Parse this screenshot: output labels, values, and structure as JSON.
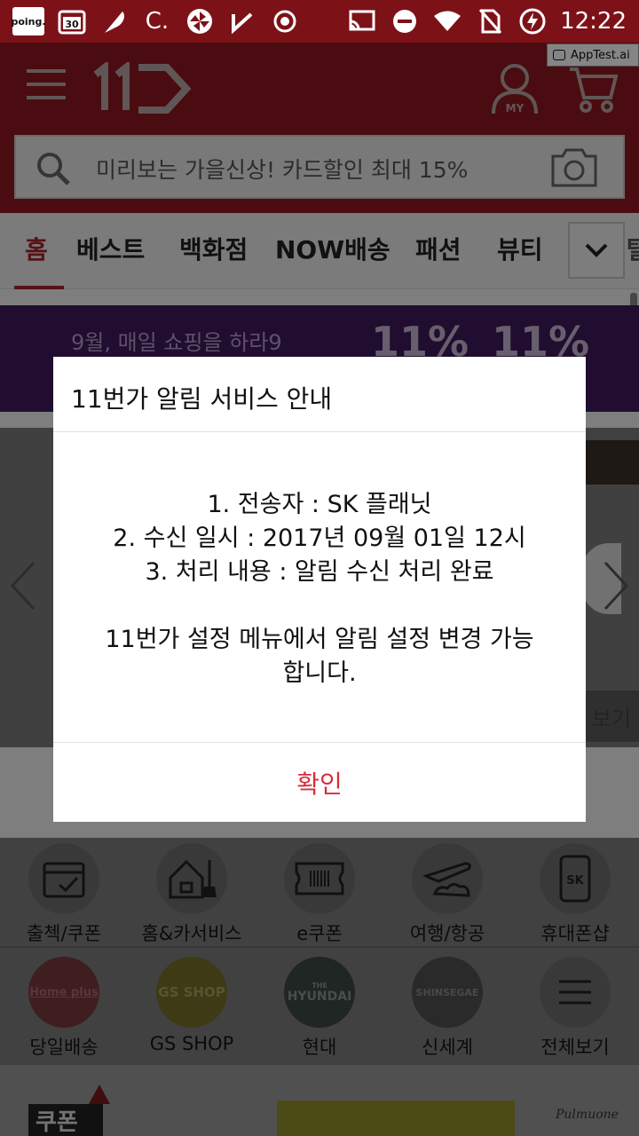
{
  "status_bar": {
    "time": "12:22",
    "left_icons": [
      "poing-app-icon",
      "calendar-icon",
      "feather-icon",
      "c-app-icon",
      "pinwheel-icon",
      "checkmark-icon",
      "record-icon"
    ],
    "poing_label": "poing.",
    "calendar_day": "30",
    "c_label": "C.",
    "right_icons": [
      "cast-icon",
      "do-not-disturb-icon",
      "wifi-icon",
      "no-sim-icon",
      "battery-charging-icon"
    ]
  },
  "watermark": {
    "label": "AppTest.ai"
  },
  "header": {
    "logo": "11번가",
    "my_label": "MY",
    "search_placeholder": "미리보는 가을신상! 카드할인 최대 15%"
  },
  "tabs": {
    "items": [
      {
        "label": "홈",
        "active": true
      },
      {
        "label": "베스트"
      },
      {
        "label": "백화점"
      },
      {
        "label": "NOW배송"
      },
      {
        "label": "패션"
      },
      {
        "label": "뷰티"
      },
      {
        "label": "디지털"
      }
    ]
  },
  "banner": {
    "text": "9월, 매일 쇼핑을 하라9",
    "badge_1": "11%",
    "badge_2": "11%"
  },
  "carousel": {
    "more_label": "보기"
  },
  "categories": {
    "row1": [
      {
        "label": "출첵/쿠폰",
        "icon": "calendar-check-icon"
      },
      {
        "label": "홈&카서비스",
        "icon": "house-broom-icon"
      },
      {
        "label": "e쿠폰",
        "icon": "barcode-ticket-icon"
      },
      {
        "label": "여행/항공",
        "icon": "airplane-icon"
      },
      {
        "label": "휴대폰샵",
        "icon": "phone-sk-icon",
        "badge": "SK"
      }
    ],
    "row2": [
      {
        "label": "당일배송",
        "brand": "Home plus"
      },
      {
        "label": "GS SHOP",
        "brand": "GS SHOP"
      },
      {
        "label": "현대",
        "brand_small": "THE",
        "brand": "HYUNDAI"
      },
      {
        "label": "신세계",
        "brand": "SHINSEGAE"
      },
      {
        "label": "전체보기",
        "icon": "menu-lines-icon"
      }
    ]
  },
  "bottom": {
    "left_text": "쿠폰",
    "right_text": "Pulmuone"
  },
  "dialog": {
    "title": "11번가 알림 서비스 안내",
    "line1": "1. 전송자 : SK 플래닛",
    "line2": "2. 수신 일시 : 2017년 09월 01일 12시",
    "line3": "3. 처리 내용 : 알림 수신 처리 완료",
    "line4": "11번가 설정 메뉴에서 알림 설정 변경 가능",
    "line5": "합니다.",
    "confirm_label": "확인",
    "confirm_color": "#d62d3a"
  }
}
